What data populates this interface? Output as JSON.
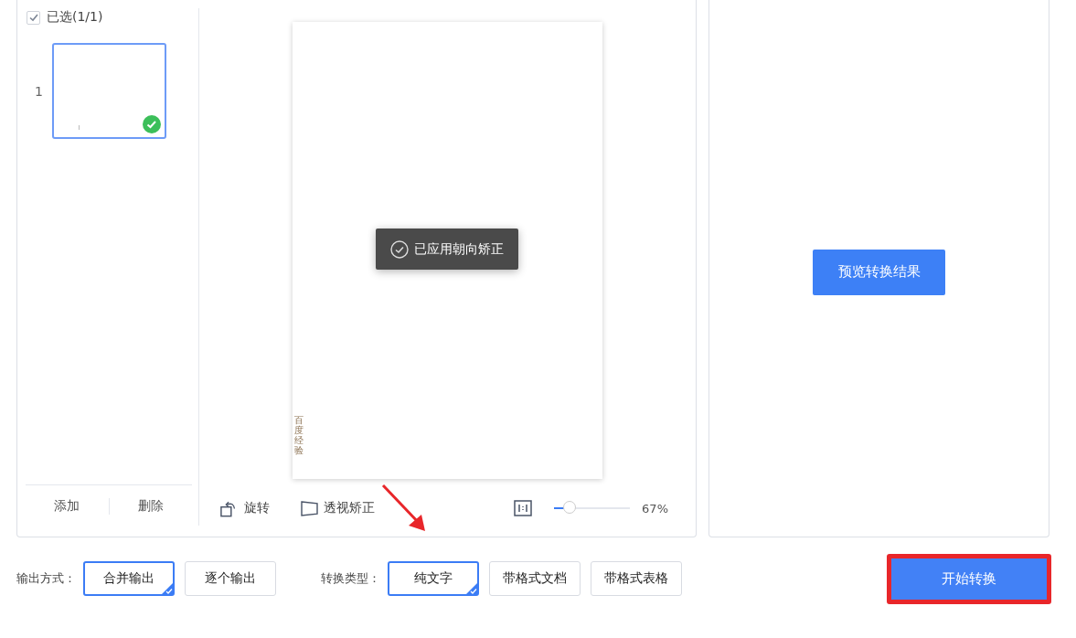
{
  "select_all": {
    "label": "已选(1/1)",
    "checked": true
  },
  "pages": [
    {
      "number": "1",
      "selected": true
    }
  ],
  "page_actions": [
    "添加",
    "删除"
  ],
  "preview": {
    "page_text": "百度经验",
    "toast": "已应用朝向矫正"
  },
  "tools": [
    {
      "kind": "rotate",
      "label": "旋转"
    },
    {
      "kind": "perspective",
      "label": "透视矫正"
    }
  ],
  "zoom": {
    "level": 0.2,
    "reading": "67%"
  },
  "result": {
    "button": "预览转换结果"
  },
  "output_mode": {
    "label": "输出方式：",
    "options": [
      {
        "label": "合并输出",
        "selected": true
      },
      {
        "label": "逐个输出",
        "selected": false
      }
    ]
  },
  "convert_type": {
    "label": "转换类型：",
    "options": [
      {
        "label": "纯文字",
        "selected": true
      },
      {
        "label": "带格式文档",
        "selected": false
      },
      {
        "label": "带格式表格",
        "selected": false
      }
    ]
  },
  "start_button": "开始转换"
}
